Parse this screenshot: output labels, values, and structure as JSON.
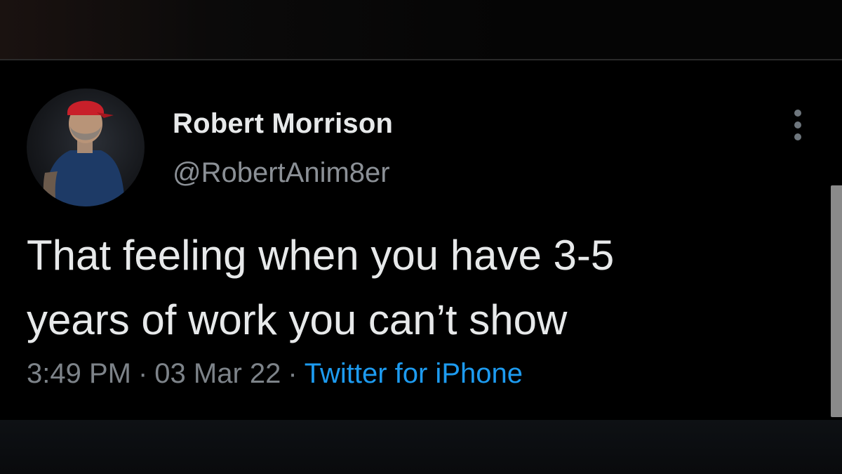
{
  "tweet": {
    "author": {
      "display_name": "Robert Morrison",
      "handle": "@RobertAnim8er",
      "avatar_icon": "profile-photo"
    },
    "text_lines": [
      "That feeling when you have 3-5",
      "years of work you can’t show"
    ],
    "time": "3:49 PM",
    "date": "03 Mar 22",
    "separator": "·",
    "source": "Twitter for iPhone",
    "more_icon": "more-vertical-icon"
  },
  "colors": {
    "background": "#000000",
    "text_primary": "#e7e9ea",
    "text_secondary": "#7d8389",
    "link": "#1d9bf0"
  }
}
